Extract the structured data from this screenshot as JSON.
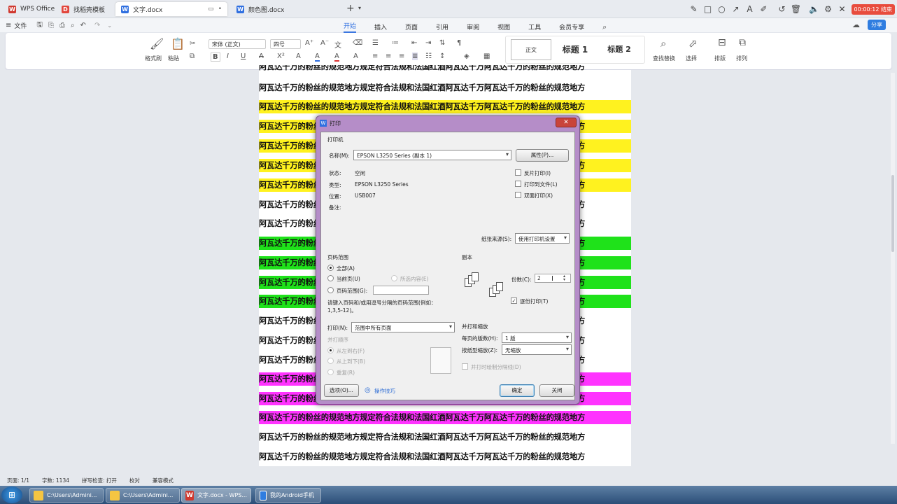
{
  "titlebar": {
    "tabs": [
      {
        "label": "WPS Office",
        "icon": "wps-logo-icon",
        "color": "#d0392f"
      },
      {
        "label": "找稻壳模板",
        "icon": "docer-icon",
        "color": "#e2463c"
      },
      {
        "label": "文字.docx",
        "icon": "wps-writer-icon",
        "color": "#2f6fe0"
      },
      {
        "label": "颜色图.docx",
        "icon": "wps-writer-icon",
        "color": "#2f6fe0"
      }
    ],
    "new_tab": "+",
    "timer": "00:00:12 结束"
  },
  "menubar": {
    "file": "文件",
    "items": [
      "开始",
      "插入",
      "页面",
      "引用",
      "审阅",
      "视图",
      "工具",
      "会员专享"
    ],
    "active": "开始",
    "share": "分享"
  },
  "ribbon": {
    "format_painter": "格式刷",
    "paste": "粘贴",
    "font_name": "宋体 (正文)",
    "font_size": "四号",
    "style_normal": "正文",
    "style_h1": "标题 1",
    "style_h2": "标题 2",
    "find_replace": "查找替换",
    "select": "选择",
    "layout": "排版",
    "arrange": "排列"
  },
  "document": {
    "text": "阿瓦达千万的粉丝的规范地方规定符合法规和法国红酒阿瓦达千万阿瓦达千万的粉丝的规范地方",
    "text_short": "阿瓦达千万的粉",
    "text_right": "的规范地方",
    "colors": {
      "yellow": "#fff21f",
      "green": "#1fe21a",
      "magenta": "#ff33ff"
    }
  },
  "dialog": {
    "title": "打印",
    "printer_group": "打印机",
    "name_label": "名称(M):",
    "printer_name": "EPSON L3250 Series (副本 1)",
    "properties": "属性(P)...",
    "status_label": "状态:",
    "status_value": "空闲",
    "type_label": "类型:",
    "type_value": "EPSON L3250 Series",
    "location_label": "位置:",
    "location_value": "USB007",
    "comment_label": "备注:",
    "reverse_print": "反片打印(I)",
    "print_to_file": "打印到文件(L)",
    "duplex": "双面打印(X)",
    "paper_source_label": "纸张来源(S):",
    "paper_source": "使用打印机设置",
    "page_range_group": "页码范围",
    "all": "全部(A)",
    "current_page": "当前页(U)",
    "selection": "所选内容(E)",
    "page_range": "页码范围(G):",
    "range_hint": "请键入页码和/或用逗号分隔的页码范围(例如：1,3,5-12)。",
    "copies_group": "副本",
    "copies_label": "份数(C):",
    "copies_value": "2",
    "collate": "逐份打印(T)",
    "print_label": "打印(N):",
    "print_value": "范围中所有页面",
    "merge_order": "并打顺序",
    "left_to_right": "从左到右(F)",
    "top_to_bottom": "从上到下(B)",
    "repeat": "重复(R)",
    "merge_zoom": "并打和缩放",
    "pages_per_sheet_label": "每页的版数(H):",
    "pages_per_sheet": "1 版",
    "scale_label": "按纸型缩放(Z):",
    "scale_value": "无缩放",
    "draw_borders": "并打时绘制分隔线(D)",
    "options": "选项(O)...",
    "tips": "操作技巧",
    "ok": "确定",
    "close": "关闭"
  },
  "statusbar": {
    "page": "页面: 1/1",
    "words": "字数: 1134",
    "spell": "拼写检查: 打开",
    "proof": "校对",
    "compat": "兼容模式"
  },
  "taskbar": {
    "items": [
      {
        "label": "C:\\Users\\Admini...",
        "icon": "folder-icon"
      },
      {
        "label": "C:\\Users\\Admini...",
        "icon": "folder-icon"
      },
      {
        "label": "文字.docx - WPS...",
        "icon": "wps-icon"
      },
      {
        "label": "我的Android手机",
        "icon": "phone-icon"
      }
    ]
  }
}
